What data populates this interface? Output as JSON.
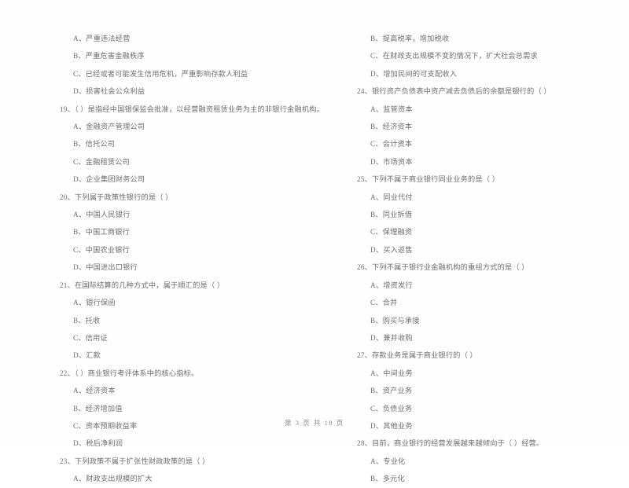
{
  "document": {
    "type": "exam-paper-scan",
    "footer": {
      "prefix": "第",
      "current_page": "3",
      "middle": "页  共",
      "total_pages": "18",
      "suffix": "页",
      "full_text": "第 3 页 共 18 页"
    }
  },
  "left_column": [
    {
      "kind": "option",
      "text": "A、严重违法经营"
    },
    {
      "kind": "option",
      "text": "B、严重危害金融秩序"
    },
    {
      "kind": "option",
      "text": "C、已经或者可能发生信用危机，严重影响存款人利益"
    },
    {
      "kind": "option",
      "text": "D、损害社会公众利益"
    },
    {
      "kind": "question",
      "text": "19、（      ）是指经中国银保监会批准，以经营融资租赁业务为主的非银行金融机构。"
    },
    {
      "kind": "option",
      "text": "A、金融资产管理公司"
    },
    {
      "kind": "option",
      "text": "B、信托公司"
    },
    {
      "kind": "option",
      "text": "C、金融租赁公司"
    },
    {
      "kind": "option",
      "text": "D、企业集团财务公司"
    },
    {
      "kind": "question",
      "text": "20、下列属于政策性银行的是（      ）"
    },
    {
      "kind": "option",
      "text": "A、中国人民银行"
    },
    {
      "kind": "option",
      "text": "B、中国工商银行"
    },
    {
      "kind": "option",
      "text": "C、中国农业银行"
    },
    {
      "kind": "option",
      "text": "D、中国进出口银行"
    },
    {
      "kind": "question",
      "text": "21、在国际结算的几种方式中，属于顺汇的是（      ）"
    },
    {
      "kind": "option",
      "text": "A、银行保函"
    },
    {
      "kind": "option",
      "text": "B、托收"
    },
    {
      "kind": "option",
      "text": "C、信用证"
    },
    {
      "kind": "option",
      "text": "D、汇款"
    },
    {
      "kind": "question",
      "text": "22、（      ）商业银行考评体系中的核心指标。"
    },
    {
      "kind": "option",
      "text": "A、经济资本"
    },
    {
      "kind": "option",
      "text": "B、经济增加值"
    },
    {
      "kind": "option",
      "text": "C、资本预期收益率"
    },
    {
      "kind": "option",
      "text": "D、税后净利润"
    },
    {
      "kind": "question",
      "text": "23、下列政策不属于扩张性财政政策的是（      ）"
    },
    {
      "kind": "option",
      "text": "A、财政支出规模的扩大"
    }
  ],
  "right_column": [
    {
      "kind": "option",
      "text": "B、提高税率，增加税收"
    },
    {
      "kind": "option",
      "text": "C、在财政支出规模不变的情况下，扩大社会总需求"
    },
    {
      "kind": "option",
      "text": "D、增加民间的可支配收入"
    },
    {
      "kind": "question",
      "text": "24、银行资产负债表中资产减去负债后的余额是银行的（      ）"
    },
    {
      "kind": "option",
      "text": "A、监管资本"
    },
    {
      "kind": "option",
      "text": "B、经济资本"
    },
    {
      "kind": "option",
      "text": "C、会计资本"
    },
    {
      "kind": "option",
      "text": "D、市场资本"
    },
    {
      "kind": "question",
      "text": "25、下列不属于商业银行同业业务的是（      ）"
    },
    {
      "kind": "option",
      "text": "A、同业代付"
    },
    {
      "kind": "option",
      "text": "B、同业拆借"
    },
    {
      "kind": "option",
      "text": "C、保理融资"
    },
    {
      "kind": "option",
      "text": "D、买入返售"
    },
    {
      "kind": "question",
      "text": "26、下列不属于银行业金融机构的重组方式的是（      ）"
    },
    {
      "kind": "option",
      "text": "A、增资发行"
    },
    {
      "kind": "option",
      "text": "C、合并"
    },
    {
      "kind": "option",
      "text": "B、购买与承接"
    },
    {
      "kind": "option",
      "text": "D、兼并收购"
    },
    {
      "kind": "question",
      "text": "27、存款业务是属于商业银行的（      ）"
    },
    {
      "kind": "option",
      "text": "A、中间业务"
    },
    {
      "kind": "option",
      "text": "B、资产业务"
    },
    {
      "kind": "option",
      "text": "C、负债业务"
    },
    {
      "kind": "option",
      "text": "D、其他业务"
    },
    {
      "kind": "question",
      "text": "28、目前，商业银行的经营发展越来越倾向于（      ）经营。"
    },
    {
      "kind": "option",
      "text": "A、专业化"
    },
    {
      "kind": "option",
      "text": "B、多元化"
    }
  ]
}
